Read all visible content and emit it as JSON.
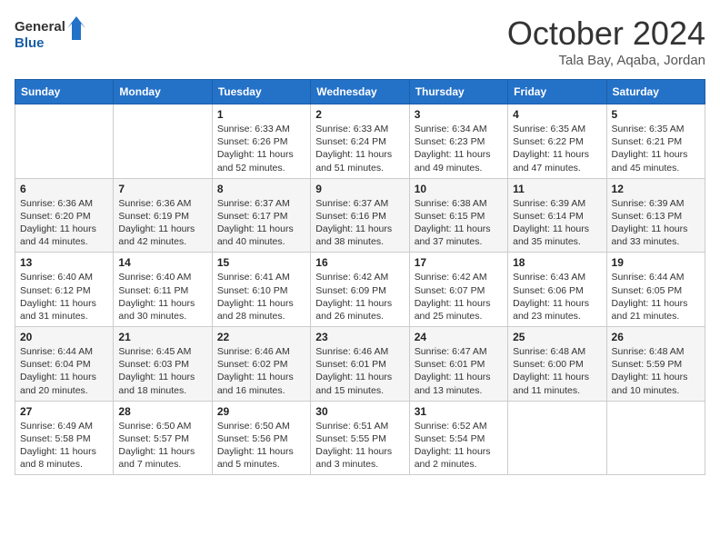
{
  "logo": {
    "line1": "General",
    "line2": "Blue"
  },
  "title": "October 2024",
  "location": "Tala Bay, Aqaba, Jordan",
  "weekdays": [
    "Sunday",
    "Monday",
    "Tuesday",
    "Wednesday",
    "Thursday",
    "Friday",
    "Saturday"
  ],
  "weeks": [
    [
      {
        "day": "",
        "info": ""
      },
      {
        "day": "",
        "info": ""
      },
      {
        "day": "1",
        "sunrise": "6:33 AM",
        "sunset": "6:26 PM",
        "daylight": "11 hours and 52 minutes."
      },
      {
        "day": "2",
        "sunrise": "6:33 AM",
        "sunset": "6:24 PM",
        "daylight": "11 hours and 51 minutes."
      },
      {
        "day": "3",
        "sunrise": "6:34 AM",
        "sunset": "6:23 PM",
        "daylight": "11 hours and 49 minutes."
      },
      {
        "day": "4",
        "sunrise": "6:35 AM",
        "sunset": "6:22 PM",
        "daylight": "11 hours and 47 minutes."
      },
      {
        "day": "5",
        "sunrise": "6:35 AM",
        "sunset": "6:21 PM",
        "daylight": "11 hours and 45 minutes."
      }
    ],
    [
      {
        "day": "6",
        "sunrise": "6:36 AM",
        "sunset": "6:20 PM",
        "daylight": "11 hours and 44 minutes."
      },
      {
        "day": "7",
        "sunrise": "6:36 AM",
        "sunset": "6:19 PM",
        "daylight": "11 hours and 42 minutes."
      },
      {
        "day": "8",
        "sunrise": "6:37 AM",
        "sunset": "6:17 PM",
        "daylight": "11 hours and 40 minutes."
      },
      {
        "day": "9",
        "sunrise": "6:37 AM",
        "sunset": "6:16 PM",
        "daylight": "11 hours and 38 minutes."
      },
      {
        "day": "10",
        "sunrise": "6:38 AM",
        "sunset": "6:15 PM",
        "daylight": "11 hours and 37 minutes."
      },
      {
        "day": "11",
        "sunrise": "6:39 AM",
        "sunset": "6:14 PM",
        "daylight": "11 hours and 35 minutes."
      },
      {
        "day": "12",
        "sunrise": "6:39 AM",
        "sunset": "6:13 PM",
        "daylight": "11 hours and 33 minutes."
      }
    ],
    [
      {
        "day": "13",
        "sunrise": "6:40 AM",
        "sunset": "6:12 PM",
        "daylight": "11 hours and 31 minutes."
      },
      {
        "day": "14",
        "sunrise": "6:40 AM",
        "sunset": "6:11 PM",
        "daylight": "11 hours and 30 minutes."
      },
      {
        "day": "15",
        "sunrise": "6:41 AM",
        "sunset": "6:10 PM",
        "daylight": "11 hours and 28 minutes."
      },
      {
        "day": "16",
        "sunrise": "6:42 AM",
        "sunset": "6:09 PM",
        "daylight": "11 hours and 26 minutes."
      },
      {
        "day": "17",
        "sunrise": "6:42 AM",
        "sunset": "6:07 PM",
        "daylight": "11 hours and 25 minutes."
      },
      {
        "day": "18",
        "sunrise": "6:43 AM",
        "sunset": "6:06 PM",
        "daylight": "11 hours and 23 minutes."
      },
      {
        "day": "19",
        "sunrise": "6:44 AM",
        "sunset": "6:05 PM",
        "daylight": "11 hours and 21 minutes."
      }
    ],
    [
      {
        "day": "20",
        "sunrise": "6:44 AM",
        "sunset": "6:04 PM",
        "daylight": "11 hours and 20 minutes."
      },
      {
        "day": "21",
        "sunrise": "6:45 AM",
        "sunset": "6:03 PM",
        "daylight": "11 hours and 18 minutes."
      },
      {
        "day": "22",
        "sunrise": "6:46 AM",
        "sunset": "6:02 PM",
        "daylight": "11 hours and 16 minutes."
      },
      {
        "day": "23",
        "sunrise": "6:46 AM",
        "sunset": "6:01 PM",
        "daylight": "11 hours and 15 minutes."
      },
      {
        "day": "24",
        "sunrise": "6:47 AM",
        "sunset": "6:01 PM",
        "daylight": "11 hours and 13 minutes."
      },
      {
        "day": "25",
        "sunrise": "6:48 AM",
        "sunset": "6:00 PM",
        "daylight": "11 hours and 11 minutes."
      },
      {
        "day": "26",
        "sunrise": "6:48 AM",
        "sunset": "5:59 PM",
        "daylight": "11 hours and 10 minutes."
      }
    ],
    [
      {
        "day": "27",
        "sunrise": "6:49 AM",
        "sunset": "5:58 PM",
        "daylight": "11 hours and 8 minutes."
      },
      {
        "day": "28",
        "sunrise": "6:50 AM",
        "sunset": "5:57 PM",
        "daylight": "11 hours and 7 minutes."
      },
      {
        "day": "29",
        "sunrise": "6:50 AM",
        "sunset": "5:56 PM",
        "daylight": "11 hours and 5 minutes."
      },
      {
        "day": "30",
        "sunrise": "6:51 AM",
        "sunset": "5:55 PM",
        "daylight": "11 hours and 3 minutes."
      },
      {
        "day": "31",
        "sunrise": "6:52 AM",
        "sunset": "5:54 PM",
        "daylight": "11 hours and 2 minutes."
      },
      {
        "day": "",
        "info": ""
      },
      {
        "day": "",
        "info": ""
      }
    ]
  ]
}
